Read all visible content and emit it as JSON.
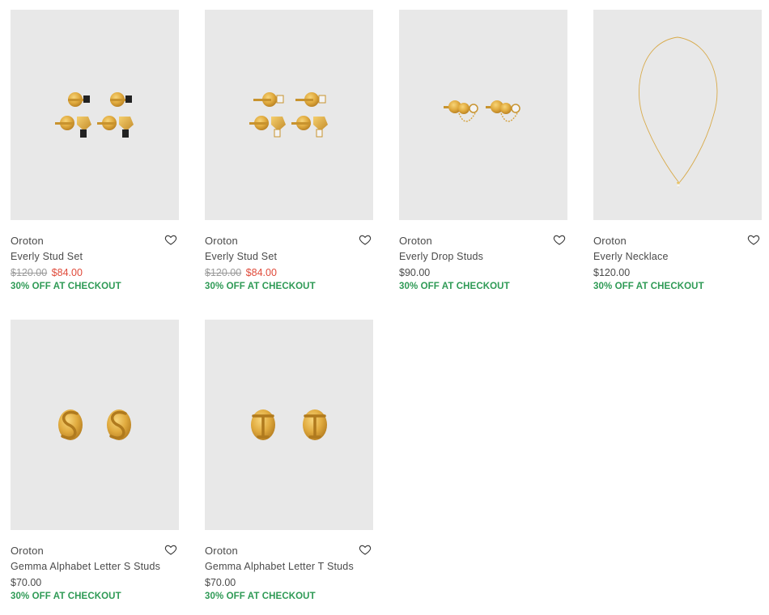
{
  "colors": {
    "image_bg": "#e8e8e8",
    "sale_price": "#e04a3a",
    "promo": "#2e9a55",
    "gold": "#d9a53a"
  },
  "products": [
    {
      "brand": "Oroton",
      "name": "Everly Stud Set",
      "original_price": "$120.00",
      "price": "$84.00",
      "promo": "30% OFF AT CHECKOUT",
      "image_icon": "stud-set-black-stone-image",
      "wishlist_icon": "heart-icon"
    },
    {
      "brand": "Oroton",
      "name": "Everly Stud Set",
      "original_price": "$120.00",
      "price": "$84.00",
      "promo": "30% OFF AT CHECKOUT",
      "image_icon": "stud-set-white-stone-image",
      "wishlist_icon": "heart-icon"
    },
    {
      "brand": "Oroton",
      "name": "Everly Drop Studs",
      "price": "$90.00",
      "promo": "30% OFF AT CHECKOUT",
      "image_icon": "drop-studs-image",
      "wishlist_icon": "heart-icon"
    },
    {
      "brand": "Oroton",
      "name": "Everly Necklace",
      "price": "$120.00",
      "promo": "30% OFF AT CHECKOUT",
      "image_icon": "necklace-image",
      "wishlist_icon": "heart-icon"
    },
    {
      "brand": "Oroton",
      "name": "Gemma Alphabet Letter S Studs",
      "price": "$70.00",
      "promo": "30% OFF AT CHECKOUT",
      "image_icon": "letter-s-studs-image",
      "wishlist_icon": "heart-icon"
    },
    {
      "brand": "Oroton",
      "name": "Gemma Alphabet Letter T Studs",
      "price": "$70.00",
      "promo": "30% OFF AT CHECKOUT",
      "image_icon": "letter-t-studs-image",
      "wishlist_icon": "heart-icon"
    }
  ]
}
